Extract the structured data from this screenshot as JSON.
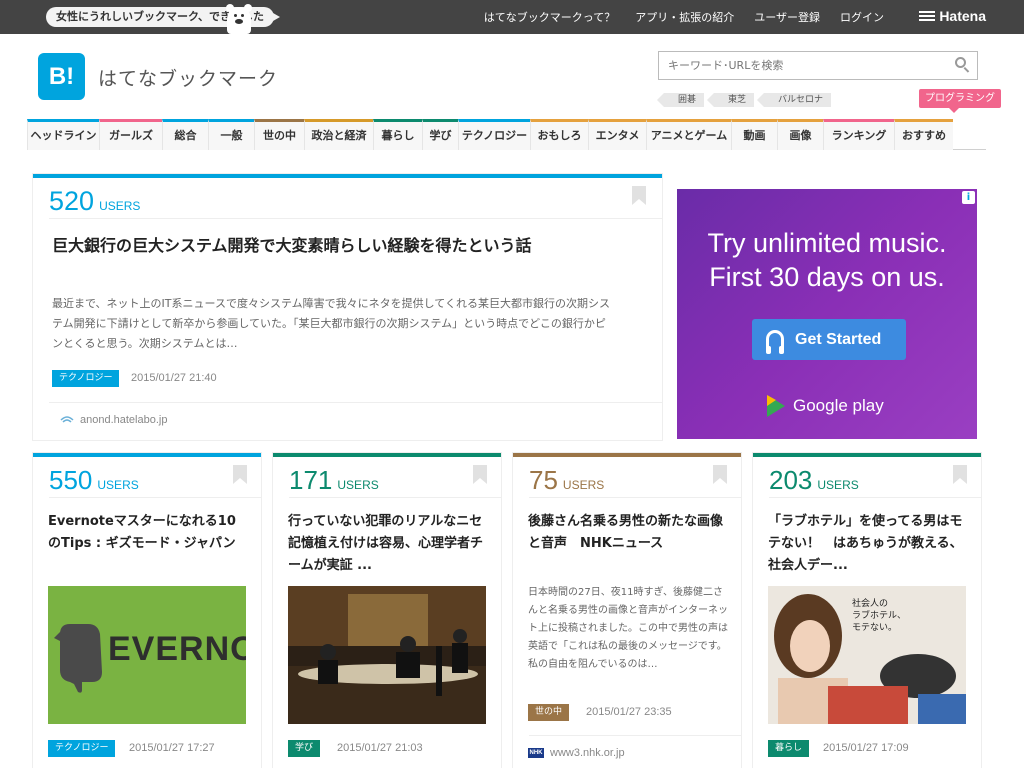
{
  "topbar": {
    "promo": "女性にうれしいブックマーク、できました",
    "links": [
      "はてなブックマークって？",
      "アプリ・拡張の紹介",
      "ユーザー登録",
      "ログイン"
    ],
    "brand": "Hatena"
  },
  "header": {
    "logo_text": "B!",
    "site_title": "はてなブックマーク",
    "search_placeholder": "キーワード･URLを検索",
    "tags": [
      "囲碁",
      "東芝",
      "バルセロナ"
    ],
    "highlight_tag": "プログラミング"
  },
  "categories": [
    {
      "label": "ヘッドライン",
      "color": "#00a4de"
    },
    {
      "label": "ガールズ",
      "color": "#f1658c"
    },
    {
      "label": "総合",
      "color": "#00a4de"
    },
    {
      "label": "一般",
      "color": "#00a4de"
    },
    {
      "label": "世の中",
      "color": "#9b7547"
    },
    {
      "label": "政治と経済",
      "color": "#d69a2a"
    },
    {
      "label": "暮らし",
      "color": "#0c8a6e"
    },
    {
      "label": "学び",
      "color": "#0c8a6e"
    },
    {
      "label": "テクノロジー",
      "color": "#00a4de"
    },
    {
      "label": "おもしろ",
      "color": "#e5a13e"
    },
    {
      "label": "エンタメ",
      "color": "#e5a13e"
    },
    {
      "label": "アニメとゲーム",
      "color": "#e5a13e"
    },
    {
      "label": "動画",
      "color": "#e5a13e"
    },
    {
      "label": "画像",
      "color": "#e5a13e"
    },
    {
      "label": "ランキング",
      "color": "#f1658c"
    },
    {
      "label": "おすすめ",
      "color": "#e5a13e"
    }
  ],
  "featured": {
    "users": "520",
    "users_label": "USERS",
    "title": "巨大銀行の巨大システム開発で大変素晴らしい経験を得たという話",
    "description": "最近まで、ネット上のIT系ニュースで度々システム障害で我々にネタを提供してくれる某巨大都市銀行の次期システム開発に下請けとして新卒から参画していた。「某巨大都市銀行の次期システム」という時点でどこの銀行かピンとくると思う。次期システムとは…",
    "category": "テクノロジー",
    "date": "2015/01/27 21:40",
    "source": "anond.hatelabo.jp",
    "color": "#00a4de"
  },
  "ad": {
    "headline_1": "Try unlimited music.",
    "headline_2": "First 30 days on us.",
    "button": "Get Started",
    "store": "Google play",
    "info": "i"
  },
  "cards": [
    {
      "users": "550",
      "users_label": "USERS",
      "title": "Evernoteマスターになれる10のTips : ギズモード・ジャパン",
      "category": "テクノロジー",
      "date": "2015/01/27 17:27",
      "color": "#00a4de",
      "thumb_text": "EVERNOTE"
    },
    {
      "users": "171",
      "users_label": "USERS",
      "title": "行っていない犯罪のリアルなニセ記憶植え付けは容易、心理学者チームが実証 ...",
      "category": "学び",
      "date": "2015/01/27 21:03",
      "color": "#0c8a6e"
    },
    {
      "users": "75",
      "users_label": "USERS",
      "title": "後藤さん名乗る男性の新たな画像と音声　NHKニュース",
      "description": "日本時間の27日、夜11時すぎ、後藤健二さんと名乗る男性の画像と音声がインターネット上に投稿されました。この中で男性の声は英語で「これは私の最後のメッセージです。私の自由を阻んでいるのは…",
      "category": "世の中",
      "date": "2015/01/27 23:35",
      "source": "www3.nhk.or.jp",
      "source_icon": "NHK",
      "color": "#9b7547"
    },
    {
      "users": "203",
      "users_label": "USERS",
      "title": "「ラブホテル」を使ってる男はモテない！　はあちゅうが教える、社会人デー...",
      "category": "暮らし",
      "date": "2015/01/27 17:09",
      "color": "#0c8a6e",
      "thumb_caption": "社会人の\nラブホテル、\nモテない。"
    }
  ]
}
